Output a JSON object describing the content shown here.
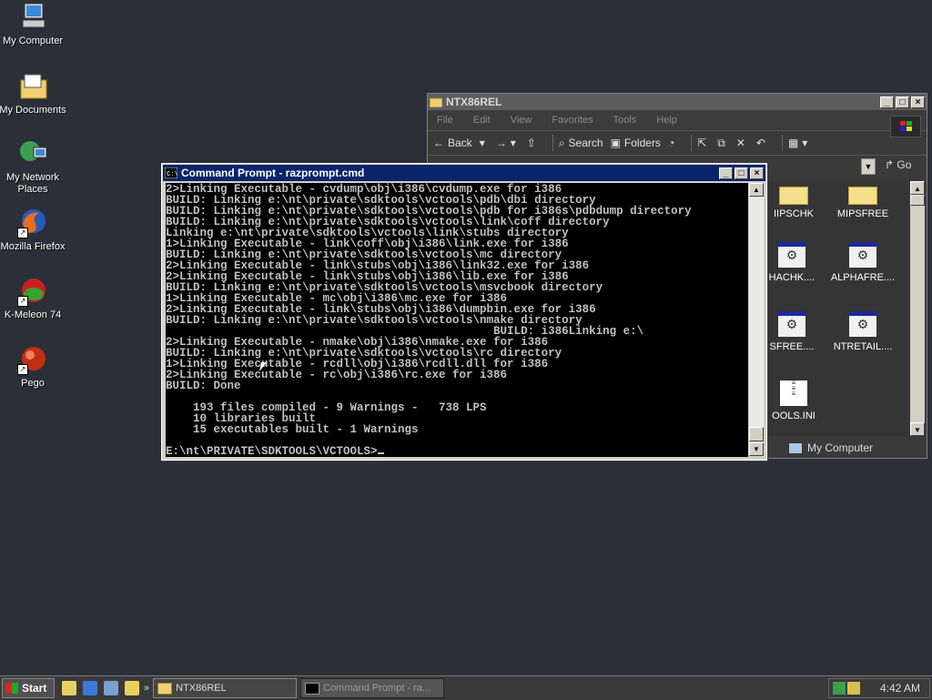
{
  "desktop": {
    "icons": [
      {
        "label": "My Computer",
        "icon": "my-computer-icon"
      },
      {
        "label": "My Documents",
        "icon": "my-documents-icon"
      },
      {
        "label": "My Network Places",
        "icon": "network-places-icon"
      },
      {
        "label": "Mozilla Firefox",
        "icon": "firefox-icon"
      },
      {
        "label": "K-Meleon 74",
        "icon": "k-meleon-icon"
      },
      {
        "label": "Pego",
        "icon": "pego-icon"
      }
    ]
  },
  "explorer": {
    "title": "NTX86REL",
    "menu": [
      "File",
      "Edit",
      "View",
      "Favorites",
      "Tools",
      "Help"
    ],
    "toolbar": {
      "back": "Back",
      "search": "Search",
      "folders": "Folders"
    },
    "address_go": "Go",
    "files": [
      {
        "name": "IIPSCHK",
        "type": "folder"
      },
      {
        "name": "MIPSFREE",
        "type": "folder"
      },
      {
        "name": "HACHK....",
        "type": "exe"
      },
      {
        "name": "ALPHAFRE....",
        "type": "exe"
      },
      {
        "name": "SFREE....",
        "type": "exe"
      },
      {
        "name": "NTRETAIL....",
        "type": "exe"
      },
      {
        "name": "OOLS.INI",
        "type": "ini"
      }
    ],
    "status": "My Computer"
  },
  "cmd": {
    "title": "Command Prompt - razprompt.cmd",
    "lines": [
      "2>Linking Executable - cvdump\\obj\\i386\\cvdump.exe for i386",
      "BUILD: Linking e:\\nt\\private\\sdktools\\vctools\\pdb\\dbi directory",
      "BUILD: Linking e:\\nt\\private\\sdktools\\vctools\\pdb for i386s\\pdbdump directory",
      "BUILD: Linking e:\\nt\\private\\sdktools\\vctools\\link\\coff directory",
      "Linking e:\\nt\\private\\sdktools\\vctools\\link\\stubs directory",
      "1>Linking Executable - link\\coff\\obj\\i386\\link.exe for i386",
      "BUILD: Linking e:\\nt\\private\\sdktools\\vctools\\mc directory",
      "2>Linking Executable - link\\stubs\\obj\\i386\\link32.exe for i386",
      "2>Linking Executable - link\\stubs\\obj\\i386\\lib.exe for i386",
      "BUILD: Linking e:\\nt\\private\\sdktools\\vctools\\msvcbook directory",
      "1>Linking Executable - mc\\obj\\i386\\mc.exe for i386",
      "2>Linking Executable - link\\stubs\\obj\\i386\\dumpbin.exe for i386",
      "BUILD: Linking e:\\nt\\private\\sdktools\\vctools\\nmake directory",
      "                                                BUILD: i386Linking e:\\",
      "2>Linking Executable - nmake\\obj\\i386\\nmake.exe for i386",
      "BUILD: Linking e:\\nt\\private\\sdktools\\vctools\\rc directory",
      "1>Linking Executable - rcdll\\obj\\i386\\rcdll.dll for i386",
      "2>Linking Executable - rc\\obj\\i386\\rc.exe for i386",
      "BUILD: Done",
      "",
      "    193 files compiled - 9 Warnings -   738 LPS",
      "    10 libraries built",
      "    15 executables built - 1 Warnings",
      ""
    ],
    "prompt": "E:\\nt\\PRIVATE\\SDKTOOLS\\VCTOOLS>"
  },
  "taskbar": {
    "start": "Start",
    "tasks": [
      {
        "label": "NTX86REL",
        "active": false
      },
      {
        "label": "Command Prompt - ra...",
        "active": true
      }
    ],
    "clock": "4:42 AM"
  }
}
